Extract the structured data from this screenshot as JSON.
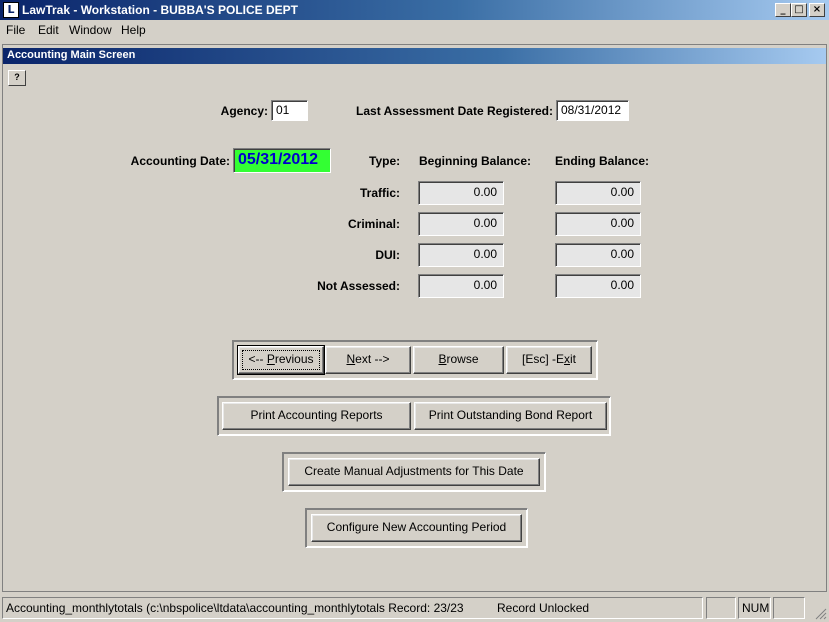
{
  "window": {
    "icon_text": "L",
    "title": "LawTrak - Workstation - BUBBA'S POLICE DEPT",
    "controls": {
      "minimize": "_",
      "maximize": "□",
      "close": "×"
    }
  },
  "menu": {
    "file": "File",
    "edit": "Edit",
    "window": "Window",
    "help": "Help"
  },
  "screen": {
    "title": "Accounting Main Screen",
    "help_button": "?"
  },
  "agency": {
    "label": "Agency:",
    "value": "01"
  },
  "last_assessment": {
    "label": "Last Assessment Date Registered:",
    "value": "08/31/2012"
  },
  "accounting_date": {
    "label": "Accounting Date:",
    "value": "05/31/2012",
    "highlight_color": "#33ff33"
  },
  "balances": {
    "headers": {
      "type": "Type:",
      "beginning": "Beginning Balance:",
      "ending": "Ending Balance:"
    },
    "rows": [
      {
        "type": "Traffic:",
        "beginning": "0.00",
        "ending": "0.00"
      },
      {
        "type": "Criminal:",
        "beginning": "0.00",
        "ending": "0.00"
      },
      {
        "type": "DUI:",
        "beginning": "0.00",
        "ending": "0.00"
      },
      {
        "type": "Not Assessed:",
        "beginning": "0.00",
        "ending": "0.00"
      }
    ]
  },
  "nav_buttons": {
    "previous": {
      "prefix": "<-- ",
      "mnemonic": "P",
      "rest": "revious"
    },
    "next": {
      "mnemonic": "N",
      "rest": "ext -->"
    },
    "browse": {
      "mnemonic": "B",
      "rest": "rowse"
    },
    "exit": {
      "prefix": "[Esc] -E",
      "mnemonic": "x",
      "rest": "it"
    }
  },
  "report_buttons": {
    "print_accounting": "Print Accounting Reports",
    "print_bond": "Print Outstanding Bond Report"
  },
  "adjust_button": "Create Manual Adjustments for This Date",
  "configure_button": "Configure New Accounting Period",
  "statusbar": {
    "record_info": "Accounting_monthlytotals (c:\\nbspolice\\ltdata\\accounting_monthlytotals Record: 23/23",
    "lock_status": "Record Unlocked",
    "num": "NUM"
  }
}
